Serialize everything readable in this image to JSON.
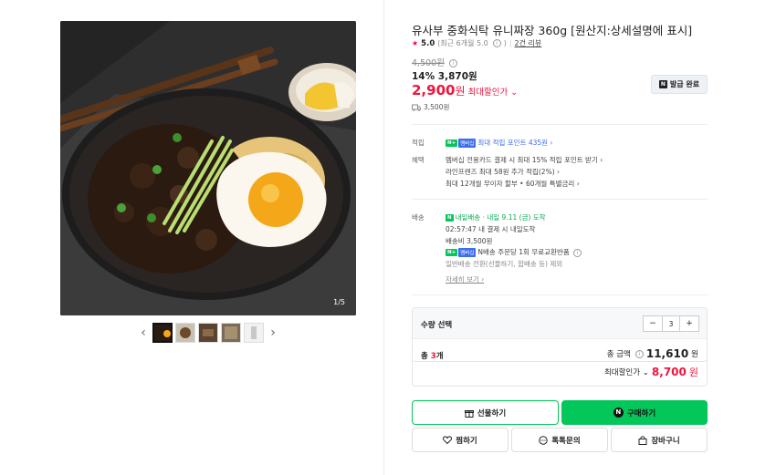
{
  "product": {
    "title": "유사부 중화식탁 유니짜장 360g [원산지:상세설명에 표시]",
    "rating_star": "★",
    "rating": "5.0",
    "rating_detail": "(최근 6개월 5.0",
    "reviews": "2건 리뷰",
    "original_price": "4,500원",
    "discount_line": "14% 3,870원",
    "max_price": "2,900",
    "max_price_unit": "원",
    "max_price_label": "최대할인가 ⌄",
    "coupon_label": "발급 완료",
    "shipping_fee": "3,500원",
    "image_counter": "1/5"
  },
  "points": {
    "label": "적립",
    "text": "최대 적립 포인트 435원 ›"
  },
  "benefits": {
    "label": "혜택",
    "lines": [
      "멤버십 전용카드 결제 시 최대 15% 적립 포인트 받기 ›",
      "라인프렌즈 최대 58원 추가 적립(2%) ›",
      "최대 12개월 무이자 할부 • 60개월 특별금리 ›"
    ]
  },
  "delivery": {
    "label": "배송",
    "type": "내일배송",
    "date": "· 내일 9.11 (금) 도착",
    "cutoff": "02:57:47  내 결제 시 내일도착",
    "fee": "배송비 3,500원",
    "exchange": "N배송 주문당 1회 무료교환반품",
    "note": "일반배송 전환(선물하기, 합배송 등) 제외",
    "more": "자세히 보기 ›"
  },
  "npay": {
    "green": "N+",
    "blue": "멤버십"
  },
  "quantity": {
    "label": "수량 선택",
    "minus": "−",
    "value": "3",
    "plus": "+"
  },
  "summary": {
    "count_prefix": "총 ",
    "count_value": "3",
    "count_suffix": "개",
    "total_label": "총 금액",
    "total_value": "11,610",
    "total_unit": "원",
    "max_label": "최대할인가 ⌄",
    "max_value": "8,700",
    "max_unit": "원"
  },
  "buttons": {
    "gift": "선물하기",
    "buy": "구매하기",
    "wish": "찜하기",
    "talk": "톡톡문의",
    "cart": "장바구니"
  },
  "icons": {
    "star": "star-icon",
    "info": "info-icon",
    "truck": "truck-icon",
    "gift": "gift-icon",
    "heart": "heart-icon",
    "chat": "chat-icon",
    "bag": "bag-icon"
  },
  "colors": {
    "accent_red": "#f0143c",
    "naver_green": "#03c75a",
    "link_blue": "#3d6ef0"
  }
}
